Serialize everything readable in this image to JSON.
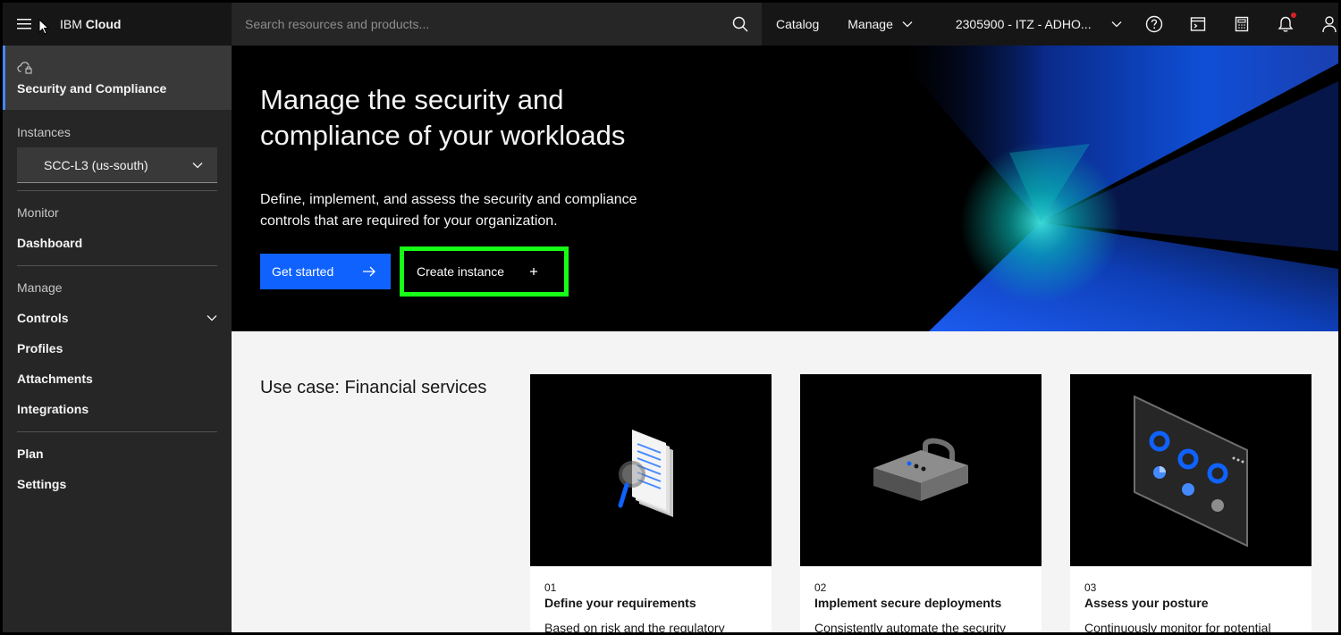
{
  "header": {
    "brand_light": "IBM ",
    "brand_bold": "Cloud",
    "search_placeholder": "Search resources and products...",
    "catalog": "Catalog",
    "manage": "Manage",
    "account": "2305900 - ITZ - ADHO...",
    "icons": [
      "help-icon",
      "cloud-shell-icon",
      "cost-estimator-icon",
      "notification-icon",
      "user-icon"
    ]
  },
  "sidebar": {
    "service_title": "Security and Compliance",
    "instances_label": "Instances",
    "instance_selected": "SCC-L3 (us-south)",
    "monitor_label": "Monitor",
    "dashboard": "Dashboard",
    "manage_label": "Manage",
    "controls": "Controls",
    "profiles": "Profiles",
    "attachments": "Attachments",
    "integrations": "Integrations",
    "plan": "Plan",
    "settings": "Settings"
  },
  "hero": {
    "title": "Manage the security and compliance of your workloads",
    "description": "Define, implement, and assess the security and compliance controls that are required for your organization.",
    "get_started": "Get started",
    "create_instance": "Create instance"
  },
  "usecase": {
    "title": "Use case: Financial services",
    "cards": [
      {
        "num": "01",
        "title": "Define your requirements",
        "desc": "Based on risk and the regulatory"
      },
      {
        "num": "02",
        "title": "Implement secure deployments",
        "desc": "Consistently automate the security"
      },
      {
        "num": "03",
        "title": "Assess your posture",
        "desc": "Continuously monitor for potential"
      }
    ]
  },
  "colors": {
    "primary": "#0f62fe",
    "highlight": "#17ff17",
    "header_bg": "#161616",
    "sidebar_bg": "#262626",
    "notification_dot": "#da1e28"
  }
}
